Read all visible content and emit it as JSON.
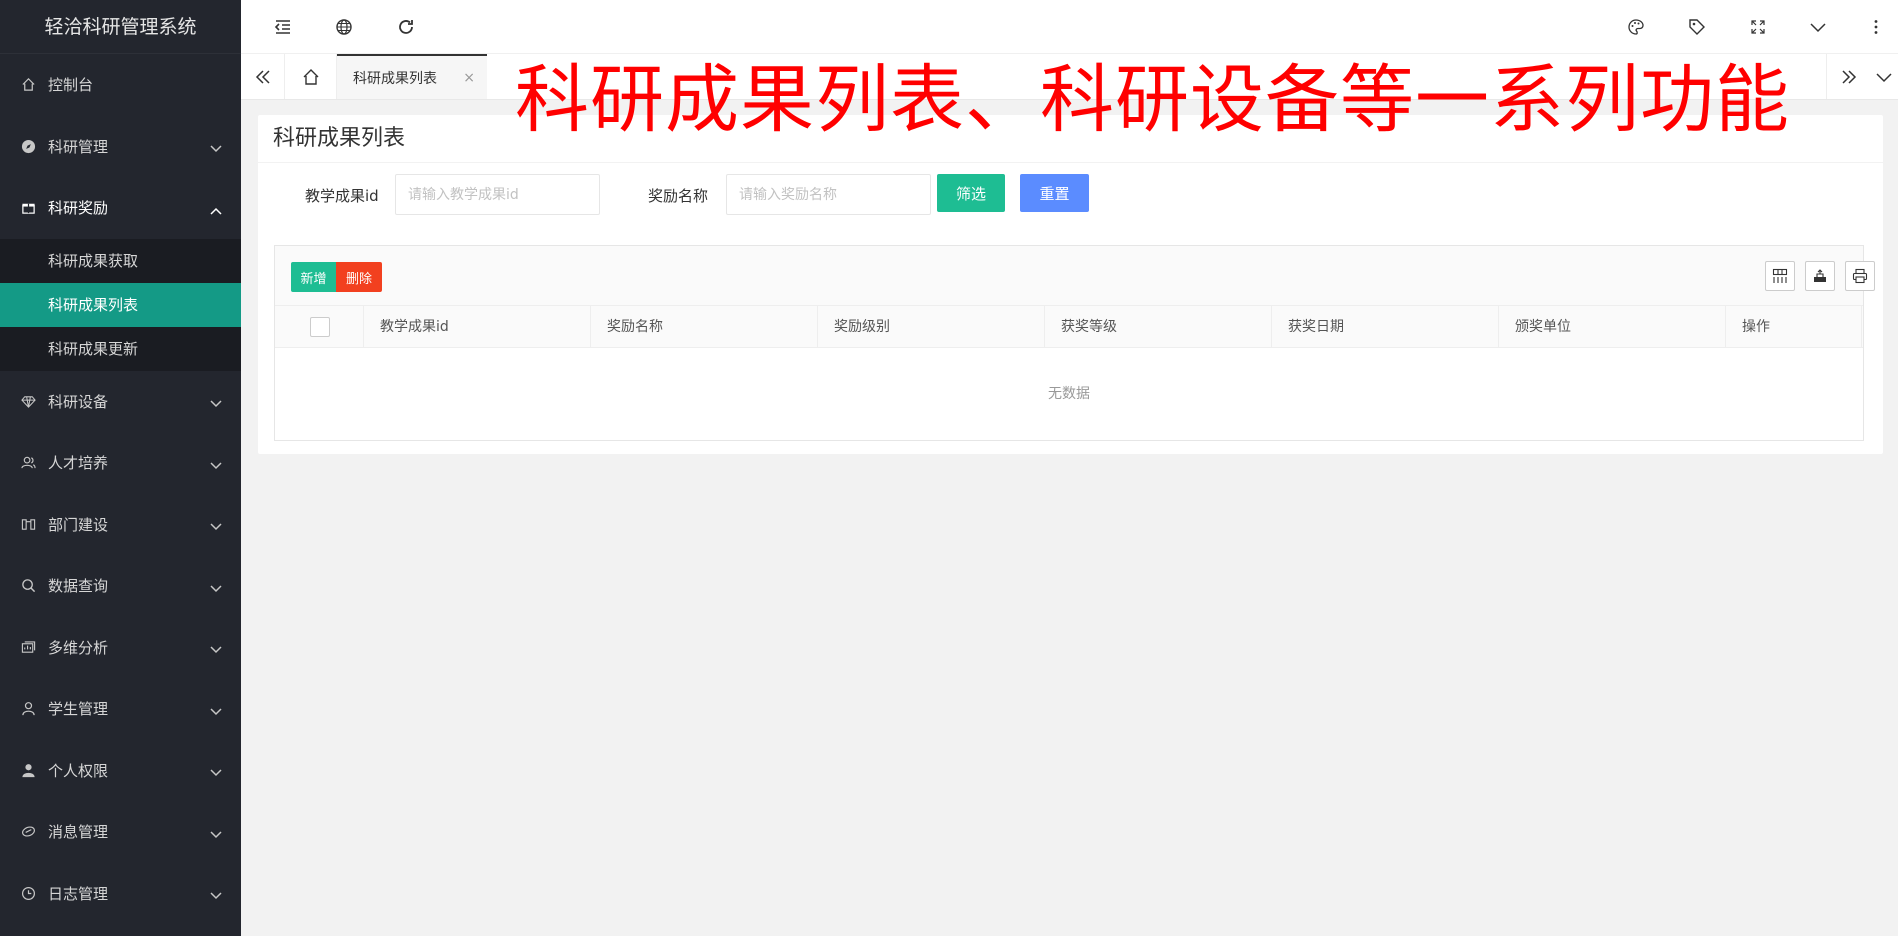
{
  "app": {
    "title": "轻洽科研管理系统"
  },
  "sidebar": {
    "items": [
      {
        "label": "控制台",
        "icon": "home-icon",
        "expandable": false
      },
      {
        "label": "科研管理",
        "icon": "compass-icon",
        "expandable": true
      },
      {
        "label": "科研奖励",
        "icon": "gift-icon",
        "expandable": true,
        "expanded": true,
        "children": [
          {
            "label": "科研成果获取"
          },
          {
            "label": "科研成果列表",
            "active": true
          },
          {
            "label": "科研成果更新"
          }
        ]
      },
      {
        "label": "科研设备",
        "icon": "diamond-icon",
        "expandable": true
      },
      {
        "label": "人才培养",
        "icon": "user-group-icon",
        "expandable": true
      },
      {
        "label": "部门建设",
        "icon": "columns-icon",
        "expandable": true
      },
      {
        "label": "数据查询",
        "icon": "search-icon",
        "expandable": true
      },
      {
        "label": "多维分析",
        "icon": "analysis-icon",
        "expandable": true
      },
      {
        "label": "学生管理",
        "icon": "user-icon",
        "expandable": true
      },
      {
        "label": "个人权限",
        "icon": "person-icon",
        "expandable": true
      },
      {
        "label": "消息管理",
        "icon": "message-icon",
        "expandable": true
      },
      {
        "label": "日志管理",
        "icon": "clock-icon",
        "expandable": true
      }
    ]
  },
  "tabs": {
    "active_label": "科研成果列表",
    "close_glyph": "×"
  },
  "banner": {
    "text": "科研成果列表、科研设备等一系列功能"
  },
  "card": {
    "title": "科研成果列表",
    "filters": {
      "field1_label": "教学成果id",
      "field1_placeholder": "请输入教学成果id",
      "field2_label": "奖励名称",
      "field2_placeholder": "请输入奖励名称",
      "filter_button": "筛选",
      "reset_button": "重置"
    },
    "toolbar": {
      "add_label": "新增",
      "delete_label": "删除"
    },
    "table": {
      "columns": [
        "教学成果id",
        "奖励名称",
        "奖励级别",
        "获奖等级",
        "获奖日期",
        "颁奖单位",
        "操作"
      ],
      "empty_text": "无数据"
    }
  },
  "colors": {
    "sidebar_bg": "#23262e",
    "active_green": "#149a86",
    "primary_green": "#1ebd93",
    "primary_blue": "#5b8cff",
    "danger_red": "#f2401f",
    "banner_red": "#ff0000"
  }
}
